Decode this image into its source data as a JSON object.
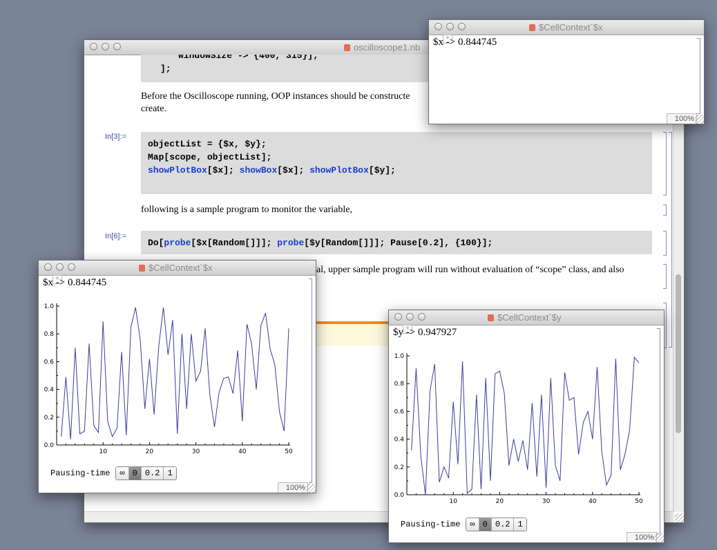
{
  "notebook": {
    "title": "oscilloscope1.nb",
    "partial_code": "windowSize -> {400, 315}];",
    "partial_close": "];",
    "text1": "Before the Oscilloscope running, OOP instances should be constructed, create.",
    "text1_line1": "Before the Oscilloscope running, OOP instances should be constructe",
    "text1_line2": "create.",
    "cell1_label": "In[3]:=",
    "cell1_line1": "objectList = {$x, $y};",
    "cell1_line2": "Map[scope, objectList];",
    "cell1_line3_parts": [
      "showPlotBox",
      "[$x]; ",
      "showBox",
      "[$x]; ",
      "showPlotBox",
      "[$y];"
    ],
    "text2": "following is a sample program to monitor the variable,",
    "cell2_label": "In[6]:=",
    "cell2_parts": [
      "Do[",
      "probe",
      "[$x[Random[]]]; ",
      "probe",
      "[$y[Random[]]]; Pause[0.2], {100}];"
    ],
    "text3": "bal, upper sample program will run without evaluation of “scope” class, and also"
  },
  "top_window": {
    "title": "$CellContext`$x",
    "readout": "$x -> 0.844745",
    "zoom": "100%"
  },
  "x_window": {
    "title": "$CellContext`$x",
    "readout": "$x -> 0.844745",
    "zoom": "100%",
    "pausing_label": "Pausing-time",
    "pausing_options": [
      "∞",
      "0",
      "0.2",
      "1"
    ],
    "pausing_selected": "0"
  },
  "y_window": {
    "title": "$CellContext`$y",
    "readout": "$y -> 0.947927",
    "zoom": "100%",
    "pausing_label": "Pausing-time",
    "pausing_options": [
      "∞",
      "0",
      "0.2",
      "1"
    ],
    "pausing_selected": "0"
  },
  "chart_data": [
    {
      "type": "line",
      "series_color": "#3b3b9c",
      "xlim": [
        0,
        50
      ],
      "ylim": [
        0,
        1.0
      ],
      "xticks": [
        10,
        20,
        30,
        40,
        50
      ],
      "yticks": [
        0.0,
        0.2,
        0.4,
        0.6,
        0.8,
        1.0
      ],
      "ytick_labels": [
        "0.0",
        "0.2",
        "0.4",
        "0.6",
        "0.8",
        "1.0"
      ],
      "x": [
        1,
        2,
        3,
        4,
        5,
        6,
        7,
        8,
        9,
        10,
        11,
        12,
        13,
        14,
        15,
        16,
        17,
        18,
        19,
        20,
        21,
        22,
        23,
        24,
        25,
        26,
        27,
        28,
        29,
        30,
        31,
        32,
        33,
        34,
        35,
        36,
        37,
        38,
        39,
        40,
        41,
        42,
        43,
        44,
        45,
        46,
        47,
        48,
        49,
        50
      ],
      "values": [
        0.06,
        0.49,
        0.04,
        0.7,
        0.08,
        0.1,
        0.73,
        0.14,
        0.09,
        0.89,
        0.17,
        0.06,
        0.12,
        0.67,
        0.07,
        0.85,
        0.99,
        0.76,
        0.26,
        0.62,
        0.22,
        0.71,
        0.99,
        0.65,
        0.9,
        0.08,
        0.8,
        0.26,
        0.8,
        0.46,
        0.53,
        0.84,
        0.36,
        0.13,
        0.38,
        0.48,
        0.49,
        0.37,
        0.68,
        0.17,
        0.87,
        0.73,
        0.4,
        0.86,
        0.95,
        0.69,
        0.58,
        0.24,
        0.1,
        0.84
      ]
    },
    {
      "type": "line",
      "series_color": "#3b3b9c",
      "xlim": [
        0,
        50
      ],
      "ylim": [
        0,
        1.0
      ],
      "xticks": [
        10,
        20,
        30,
        40,
        50
      ],
      "yticks": [
        0.0,
        0.2,
        0.4,
        0.6,
        0.8,
        1.0
      ],
      "ytick_labels": [
        "0.0",
        "0.2",
        "0.4",
        "0.6",
        "0.8",
        "1.0"
      ],
      "x": [
        1,
        2,
        3,
        4,
        5,
        6,
        7,
        8,
        9,
        10,
        11,
        12,
        13,
        14,
        15,
        16,
        17,
        18,
        19,
        20,
        21,
        22,
        23,
        24,
        25,
        26,
        27,
        28,
        29,
        30,
        31,
        32,
        33,
        34,
        35,
        36,
        37,
        38,
        39,
        40,
        41,
        42,
        43,
        44,
        45,
        46,
        47,
        48,
        49,
        50
      ],
      "values": [
        0.32,
        0.91,
        0.28,
        0.0,
        0.75,
        0.94,
        0.09,
        0.2,
        0.12,
        0.67,
        0.22,
        0.96,
        0.01,
        0.04,
        0.72,
        0.04,
        0.84,
        0.1,
        0.87,
        0.89,
        0.73,
        0.21,
        0.4,
        0.24,
        0.39,
        0.18,
        0.66,
        0.13,
        0.72,
        0.05,
        0.84,
        0.21,
        0.1,
        0.88,
        0.68,
        0.7,
        0.29,
        0.52,
        0.6,
        0.4,
        0.92,
        0.31,
        0.07,
        0.14,
        0.98,
        0.18,
        0.29,
        0.47,
        0.99,
        0.95
      ]
    }
  ]
}
